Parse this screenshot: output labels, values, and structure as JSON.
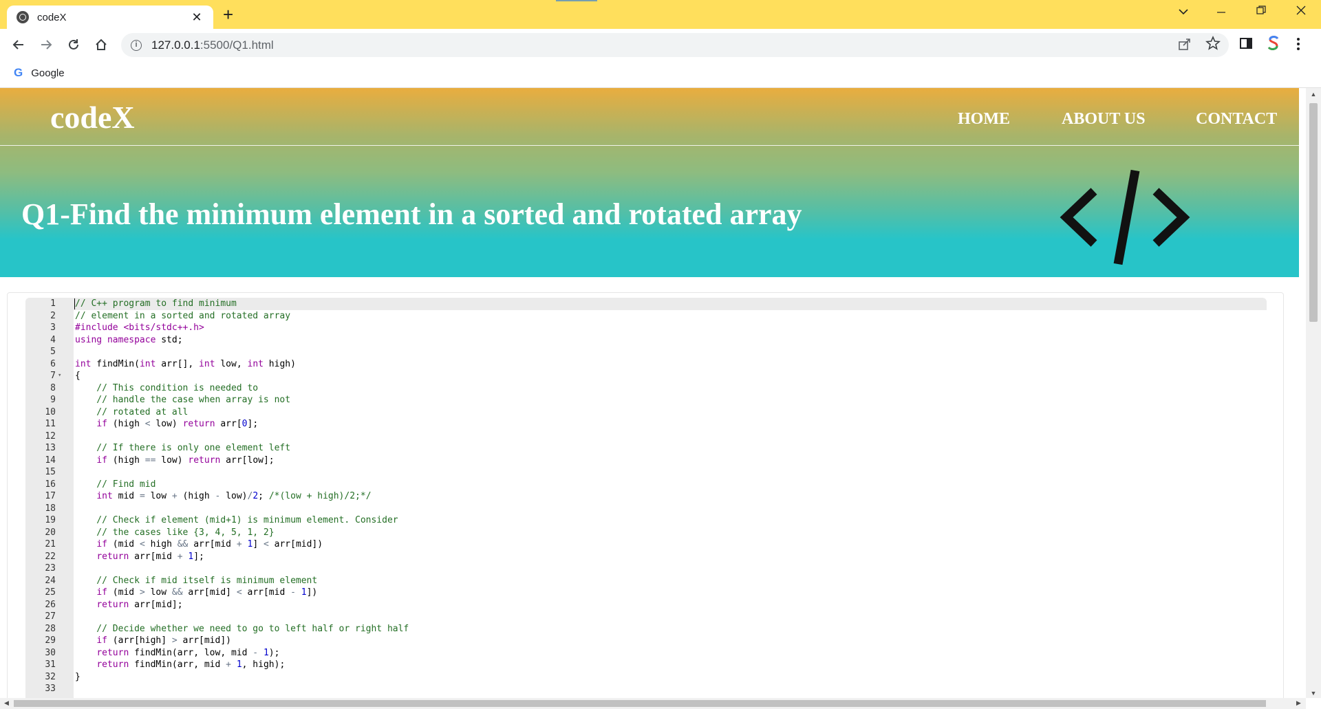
{
  "browser": {
    "tab_title": "codeX",
    "tab_close": "✕",
    "new_tab": "+",
    "url_host": "127.0.0.1",
    "url_path": ":5500/Q1.html",
    "bookmark_label": "Google",
    "bookmark_icon_letter": "G",
    "nav_icons": [
      "back-icon",
      "forward-icon",
      "reload-icon",
      "home-icon"
    ],
    "window_controls": [
      "chevron-down-icon",
      "minimize-icon",
      "restore-icon",
      "close-icon"
    ]
  },
  "site": {
    "brand": "codeX",
    "nav": [
      "HOME",
      "ABOUT US",
      "CONTACT"
    ],
    "title": "Q1-Find the minimum element in a sorted and rotated array",
    "header_colors": [
      "#e9ad3f",
      "#8dbc80",
      "#27c4c8"
    ]
  },
  "editor": {
    "lines": [
      [
        {
          "t": "// C++ program to find minimum",
          "c": "comment"
        }
      ],
      [
        {
          "t": "// element in a sorted and rotated array",
          "c": "comment"
        }
      ],
      [
        {
          "t": "#include <bits/stdc++.h>",
          "c": "pre"
        }
      ],
      [
        {
          "t": "using namespace",
          "c": "kw"
        },
        {
          "t": " std;",
          "c": ""
        }
      ],
      [],
      [
        {
          "t": "int",
          "c": "kw"
        },
        {
          "t": " findMin(",
          "c": ""
        },
        {
          "t": "int",
          "c": "kw"
        },
        {
          "t": " arr[], ",
          "c": ""
        },
        {
          "t": "int",
          "c": "kw"
        },
        {
          "t": " low, ",
          "c": ""
        },
        {
          "t": "int",
          "c": "kw"
        },
        {
          "t": " high)",
          "c": ""
        }
      ],
      [
        {
          "t": "{",
          "c": ""
        }
      ],
      [
        {
          "t": "    // This condition is needed to",
          "c": "comment"
        }
      ],
      [
        {
          "t": "    // handle the case when array is not",
          "c": "comment"
        }
      ],
      [
        {
          "t": "    // rotated at all",
          "c": "comment"
        }
      ],
      [
        {
          "t": "    ",
          "c": ""
        },
        {
          "t": "if",
          "c": "kw"
        },
        {
          "t": " (high ",
          "c": ""
        },
        {
          "t": "<",
          "c": "op"
        },
        {
          "t": " low) ",
          "c": ""
        },
        {
          "t": "return",
          "c": "kw"
        },
        {
          "t": " arr[",
          "c": ""
        },
        {
          "t": "0",
          "c": "num"
        },
        {
          "t": "];",
          "c": ""
        }
      ],
      [],
      [
        {
          "t": "    // If there is only one element left",
          "c": "comment"
        }
      ],
      [
        {
          "t": "    ",
          "c": ""
        },
        {
          "t": "if",
          "c": "kw"
        },
        {
          "t": " (high ",
          "c": ""
        },
        {
          "t": "==",
          "c": "op"
        },
        {
          "t": " low) ",
          "c": ""
        },
        {
          "t": "return",
          "c": "kw"
        },
        {
          "t": " arr[low];",
          "c": ""
        }
      ],
      [],
      [
        {
          "t": "    // Find mid",
          "c": "comment"
        }
      ],
      [
        {
          "t": "    ",
          "c": ""
        },
        {
          "t": "int",
          "c": "kw"
        },
        {
          "t": " mid ",
          "c": ""
        },
        {
          "t": "=",
          "c": "op"
        },
        {
          "t": " low ",
          "c": ""
        },
        {
          "t": "+",
          "c": "op"
        },
        {
          "t": " (high ",
          "c": ""
        },
        {
          "t": "-",
          "c": "op"
        },
        {
          "t": " low)",
          "c": ""
        },
        {
          "t": "/",
          "c": "op"
        },
        {
          "t": "2",
          "c": "num"
        },
        {
          "t": "; ",
          "c": ""
        },
        {
          "t": "/*(low + high)/2;*/",
          "c": "comment"
        }
      ],
      [],
      [
        {
          "t": "    // Check if element (mid+1) is minimum element. Consider",
          "c": "comment"
        }
      ],
      [
        {
          "t": "    // the cases like {3, 4, 5, 1, 2}",
          "c": "comment"
        }
      ],
      [
        {
          "t": "    ",
          "c": ""
        },
        {
          "t": "if",
          "c": "kw"
        },
        {
          "t": " (mid ",
          "c": ""
        },
        {
          "t": "<",
          "c": "op"
        },
        {
          "t": " high ",
          "c": ""
        },
        {
          "t": "&&",
          "c": "op"
        },
        {
          "t": " arr[mid ",
          "c": ""
        },
        {
          "t": "+",
          "c": "op"
        },
        {
          "t": " ",
          "c": ""
        },
        {
          "t": "1",
          "c": "num"
        },
        {
          "t": "] ",
          "c": ""
        },
        {
          "t": "<",
          "c": "op"
        },
        {
          "t": " arr[mid])",
          "c": ""
        }
      ],
      [
        {
          "t": "    ",
          "c": ""
        },
        {
          "t": "return",
          "c": "kw"
        },
        {
          "t": " arr[mid ",
          "c": ""
        },
        {
          "t": "+",
          "c": "op"
        },
        {
          "t": " ",
          "c": ""
        },
        {
          "t": "1",
          "c": "num"
        },
        {
          "t": "];",
          "c": ""
        }
      ],
      [],
      [
        {
          "t": "    // Check if mid itself is minimum element",
          "c": "comment"
        }
      ],
      [
        {
          "t": "    ",
          "c": ""
        },
        {
          "t": "if",
          "c": "kw"
        },
        {
          "t": " (mid ",
          "c": ""
        },
        {
          "t": ">",
          "c": "op"
        },
        {
          "t": " low ",
          "c": ""
        },
        {
          "t": "&&",
          "c": "op"
        },
        {
          "t": " arr[mid] ",
          "c": ""
        },
        {
          "t": "<",
          "c": "op"
        },
        {
          "t": " arr[mid ",
          "c": ""
        },
        {
          "t": "-",
          "c": "op"
        },
        {
          "t": " ",
          "c": ""
        },
        {
          "t": "1",
          "c": "num"
        },
        {
          "t": "])",
          "c": ""
        }
      ],
      [
        {
          "t": "    ",
          "c": ""
        },
        {
          "t": "return",
          "c": "kw"
        },
        {
          "t": " arr[mid];",
          "c": ""
        }
      ],
      [],
      [
        {
          "t": "    // Decide whether we need to go to left half or right half",
          "c": "comment"
        }
      ],
      [
        {
          "t": "    ",
          "c": ""
        },
        {
          "t": "if",
          "c": "kw"
        },
        {
          "t": " (arr[high] ",
          "c": ""
        },
        {
          "t": ">",
          "c": "op"
        },
        {
          "t": " arr[mid])",
          "c": ""
        }
      ],
      [
        {
          "t": "    ",
          "c": ""
        },
        {
          "t": "return",
          "c": "kw"
        },
        {
          "t": " findMin(arr, low, mid ",
          "c": ""
        },
        {
          "t": "-",
          "c": "op"
        },
        {
          "t": " ",
          "c": ""
        },
        {
          "t": "1",
          "c": "num"
        },
        {
          "t": ");",
          "c": ""
        }
      ],
      [
        {
          "t": "    ",
          "c": ""
        },
        {
          "t": "return",
          "c": "kw"
        },
        {
          "t": " findMin(arr, mid ",
          "c": ""
        },
        {
          "t": "+",
          "c": "op"
        },
        {
          "t": " ",
          "c": ""
        },
        {
          "t": "1",
          "c": "num"
        },
        {
          "t": ", high);",
          "c": ""
        }
      ],
      [
        {
          "t": "}",
          "c": ""
        }
      ],
      []
    ],
    "first_line_number": 1,
    "folded_line": 7,
    "fold_icon": "fold-arrow-icon"
  }
}
